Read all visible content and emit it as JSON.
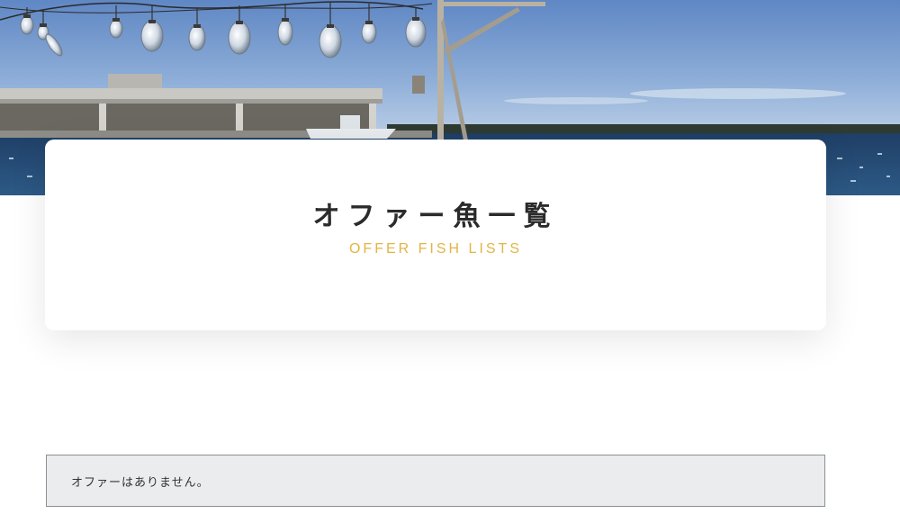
{
  "header": {
    "title": "オファー魚一覧",
    "subtitle": "OFFER FISH LISTS"
  },
  "notice": {
    "message": "オファーはありません。"
  },
  "colors": {
    "accent": "#e2b547",
    "title_text": "#2b2b2b",
    "notice_background": "#ebecee",
    "notice_border": "#8c8f94"
  }
}
